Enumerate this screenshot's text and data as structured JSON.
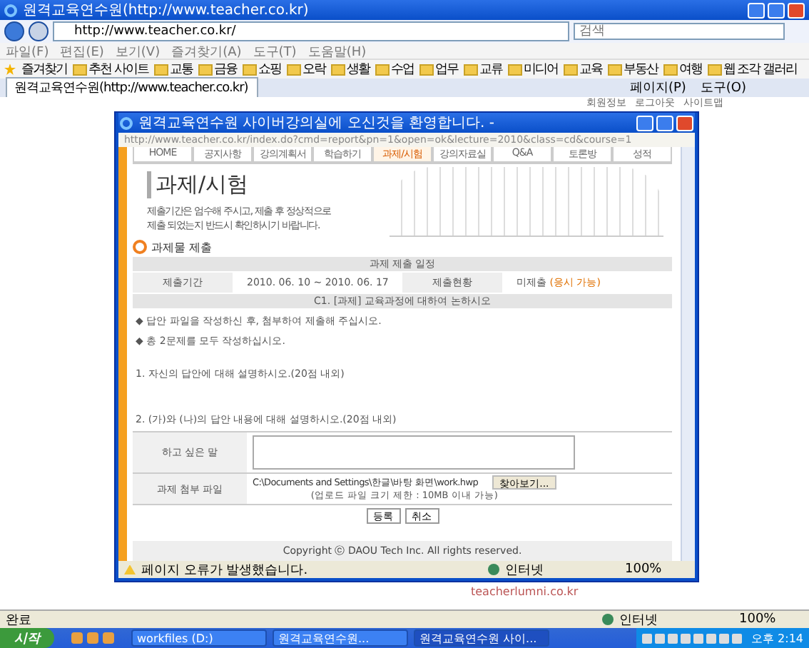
{
  "browser": {
    "title": "원격교육연수원(http://www.teacher.co.kr)",
    "address": "http://www.teacher.co.kr/",
    "search": {
      "placeholder": "검색"
    },
    "menu": [
      "파일(F)",
      "편집(E)",
      "보기(V)",
      "즐겨찾기(A)",
      "도구(T)",
      "도움말(H)"
    ],
    "favorites_label": "즐겨찾기",
    "favorites": [
      "추천 사이트",
      "교통",
      "금융",
      "쇼핑",
      "오락",
      "생활",
      "수업",
      "업무",
      "교류",
      "미디어",
      "교육",
      "부동산",
      "여행",
      "웹 조각 갤러리"
    ],
    "tab": "원격교육연수원(http://www.teacher.co.kr)",
    "tools": [
      "페이지(P)",
      "도구(O)"
    ],
    "page_links": [
      "회원정보",
      "로그아웃",
      "사이트맵"
    ],
    "page_site": "teacherlumni.co.kr",
    "status": "완료",
    "zone": "인터넷",
    "zoom": "100%"
  },
  "popup": {
    "title": "원격교육연수원 사이버강의실에 오신것을 환영합니다. -",
    "address": "http://www.teacher.co.kr/index.do?cmd=report&pn=1&open=ok&lecture=2010&class=cd&course=1",
    "nav": [
      {
        "label": "HOME",
        "selected": false
      },
      {
        "label": "공지사항",
        "selected": false
      },
      {
        "label": "강의계획서",
        "selected": false
      },
      {
        "label": "학습하기",
        "selected": false
      },
      {
        "label": "과제/시험",
        "selected": true
      },
      {
        "label": "강의자료실",
        "selected": false
      },
      {
        "label": "Q&A",
        "selected": false
      },
      {
        "label": "토론방",
        "selected": false
      },
      {
        "label": "성적",
        "selected": false
      }
    ],
    "heading": "과제/시험",
    "description": [
      "제출기간은 엄수해 주시고, 제출 후 정상적으로",
      "제출 되었는지 반드시 확인하시기 바랍니다."
    ],
    "section": "과제물 제출",
    "schedule": {
      "caption": "과제 제출 일정",
      "period_label": "제출기간",
      "period": "2010. 06. 10 ~ 2010. 06. 17",
      "status_label": "제출현황",
      "status": "미제출",
      "status_note": "(응시 가능)",
      "topic": "C1. [과제] 교육과정에 대하여 논하시오"
    },
    "notes": [
      "◆ 답안 파일을 작성하신 후, 첨부하여 제출해 주십시오.",
      "◆ 총 2문제를 모두 작성하십시오."
    ],
    "questions": [
      "1. 자신의 답안에 대해 설명하시오.(20점 내외)",
      "2. (가)와 (나)의 답안 내용에 대해 설명하시오.(20점 내외)"
    ],
    "form": {
      "message_label": "하고 싶은 말",
      "file_label": "과제 첨부 파일",
      "file_value": "C:\\Documents and Settings\\한글\\바탕 화면\\work.hwp",
      "browse": "찾아보기...",
      "hint": "(업로드 파일 크기 제한 : 10MB 이내 가능)"
    },
    "buttons": [
      "등록",
      "취소"
    ],
    "copyright": "Copyright ⓒ DAOU Tech Inc. All rights reserved.",
    "status": "페이지 오류가 발생했습니다.",
    "zone": "인터넷",
    "zoom": "100%"
  },
  "taskbar": {
    "start": "시작",
    "items": [
      {
        "label": "workfiles (D:)",
        "selected": false
      },
      {
        "label": "원격교육연수원...",
        "selected": false
      },
      {
        "label": "원격교육연수원 사이...",
        "selected": true
      }
    ],
    "clock": "오후 2:14"
  }
}
